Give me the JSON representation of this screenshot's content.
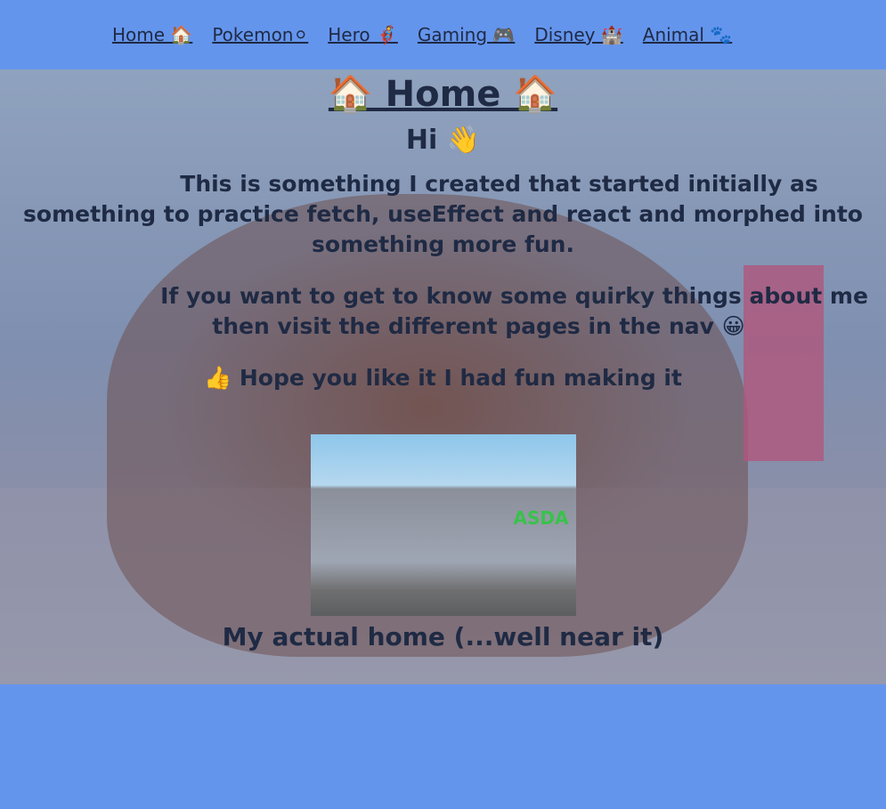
{
  "nav": [
    {
      "label": "Home 🏠"
    },
    {
      "label": "Pokemon⚪"
    },
    {
      "label": "Hero 🦸"
    },
    {
      "label": "Gaming 🎮"
    },
    {
      "label": "Disney 🏰"
    },
    {
      "label": "Animal 🐾"
    }
  ],
  "main": {
    "title": "🏠 Home 🏠",
    "greeting": "Hi 👋",
    "paragraphs": [
      "This is something I created that started initially as something to practice fetch, useEffect and react and morphed into something more fun.",
      "If you want to get to know some quirky things about me then visit the different pages in the nav 😀",
      "👍 Hope you like it I had fun making it"
    ],
    "image_sign": "ASDA",
    "caption": "My actual home (...well near it)"
  },
  "colors": {
    "background": "#6495ed",
    "text": "#1f2a44"
  }
}
